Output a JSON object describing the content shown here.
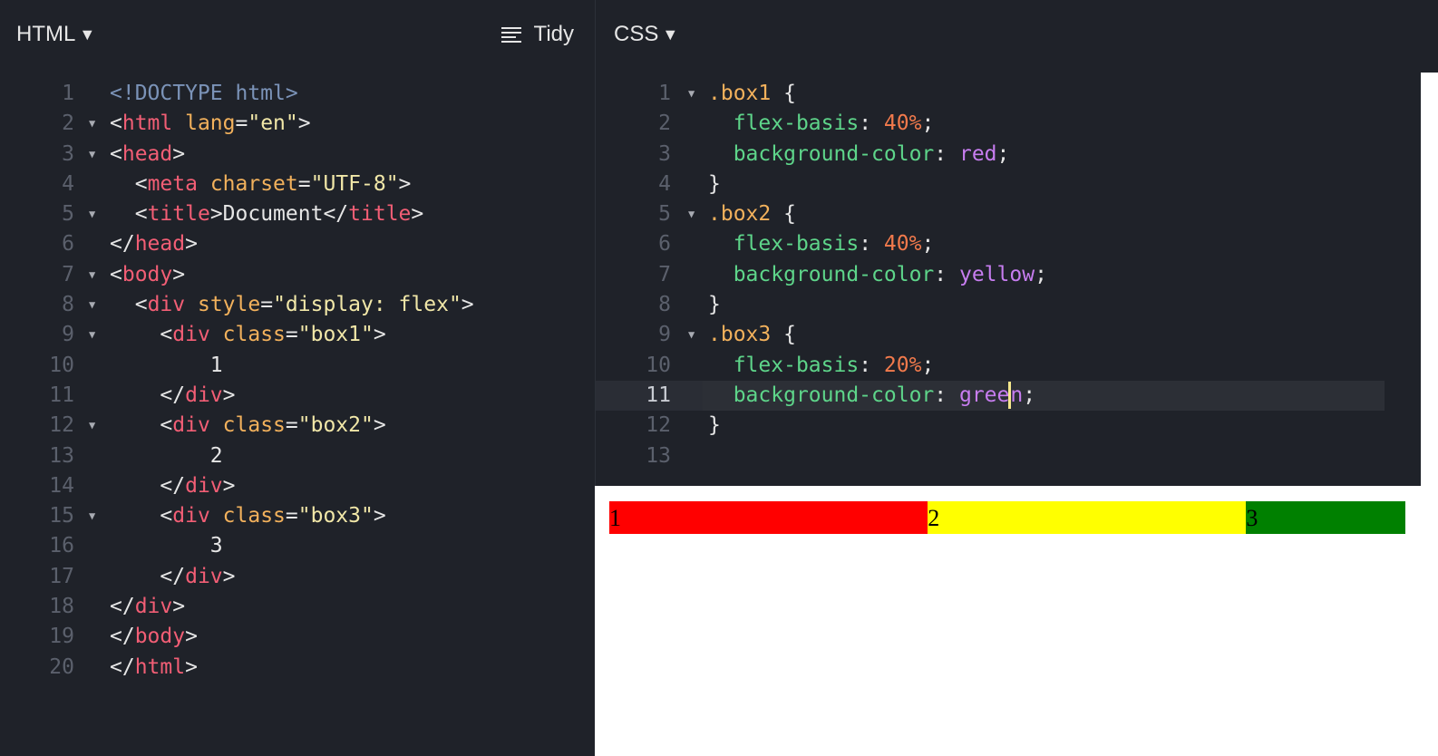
{
  "html_pane": {
    "title": "HTML",
    "caret": "▼",
    "tidy_label": "Tidy",
    "lines": [
      {
        "n": "1",
        "fold": false,
        "indent": "",
        "tokens": [
          [
            "c-doc",
            "<!DOCTYPE html>"
          ]
        ]
      },
      {
        "n": "2",
        "fold": true,
        "indent": "",
        "tokens": [
          [
            "c-punc",
            "<"
          ],
          [
            "c-tag",
            "html"
          ],
          [
            "c-punc",
            " "
          ],
          [
            "c-attr",
            "lang"
          ],
          [
            "c-punc",
            "="
          ],
          [
            "c-str",
            "\"en\""
          ],
          [
            "c-punc",
            ">"
          ]
        ]
      },
      {
        "n": "3",
        "fold": true,
        "indent": "",
        "tokens": [
          [
            "c-punc",
            "<"
          ],
          [
            "c-tag",
            "head"
          ],
          [
            "c-punc",
            ">"
          ]
        ]
      },
      {
        "n": "4",
        "fold": false,
        "indent": "  ",
        "tokens": [
          [
            "c-punc",
            "<"
          ],
          [
            "c-tag",
            "meta"
          ],
          [
            "c-punc",
            " "
          ],
          [
            "c-attr",
            "charset"
          ],
          [
            "c-punc",
            "="
          ],
          [
            "c-str",
            "\"UTF-8\""
          ],
          [
            "c-punc",
            ">"
          ]
        ]
      },
      {
        "n": "5",
        "fold": true,
        "indent": "  ",
        "tokens": [
          [
            "c-punc",
            "<"
          ],
          [
            "c-tag",
            "title"
          ],
          [
            "c-punc",
            ">"
          ],
          [
            "c-text",
            "Document"
          ],
          [
            "c-punc",
            "</"
          ],
          [
            "c-tag",
            "title"
          ],
          [
            "c-punc",
            ">"
          ]
        ]
      },
      {
        "n": "6",
        "fold": false,
        "indent": "",
        "tokens": [
          [
            "c-punc",
            "</"
          ],
          [
            "c-tag",
            "head"
          ],
          [
            "c-punc",
            ">"
          ]
        ]
      },
      {
        "n": "7",
        "fold": true,
        "indent": "",
        "tokens": [
          [
            "c-punc",
            "<"
          ],
          [
            "c-tag",
            "body"
          ],
          [
            "c-punc",
            ">"
          ]
        ]
      },
      {
        "n": "8",
        "fold": true,
        "indent": "  ",
        "tokens": [
          [
            "c-punc",
            "<"
          ],
          [
            "c-tag",
            "div"
          ],
          [
            "c-punc",
            " "
          ],
          [
            "c-attr",
            "style"
          ],
          [
            "c-punc",
            "="
          ],
          [
            "c-str",
            "\"display: flex\""
          ],
          [
            "c-punc",
            ">"
          ]
        ]
      },
      {
        "n": "9",
        "fold": true,
        "indent": "    ",
        "tokens": [
          [
            "c-punc",
            "<"
          ],
          [
            "c-tag",
            "div"
          ],
          [
            "c-punc",
            " "
          ],
          [
            "c-attr",
            "class"
          ],
          [
            "c-punc",
            "="
          ],
          [
            "c-str",
            "\"box1\""
          ],
          [
            "c-punc",
            ">"
          ]
        ]
      },
      {
        "n": "10",
        "fold": false,
        "indent": "        ",
        "tokens": [
          [
            "c-text",
            "1"
          ]
        ]
      },
      {
        "n": "11",
        "fold": false,
        "indent": "    ",
        "tokens": [
          [
            "c-punc",
            "</"
          ],
          [
            "c-tag",
            "div"
          ],
          [
            "c-punc",
            ">"
          ]
        ]
      },
      {
        "n": "12",
        "fold": true,
        "indent": "    ",
        "tokens": [
          [
            "c-punc",
            "<"
          ],
          [
            "c-tag",
            "div"
          ],
          [
            "c-punc",
            " "
          ],
          [
            "c-attr",
            "class"
          ],
          [
            "c-punc",
            "="
          ],
          [
            "c-str",
            "\"box2\""
          ],
          [
            "c-punc",
            ">"
          ]
        ]
      },
      {
        "n": "13",
        "fold": false,
        "indent": "        ",
        "tokens": [
          [
            "c-text",
            "2"
          ]
        ]
      },
      {
        "n": "14",
        "fold": false,
        "indent": "    ",
        "tokens": [
          [
            "c-punc",
            "</"
          ],
          [
            "c-tag",
            "div"
          ],
          [
            "c-punc",
            ">"
          ]
        ]
      },
      {
        "n": "15",
        "fold": true,
        "indent": "    ",
        "tokens": [
          [
            "c-punc",
            "<"
          ],
          [
            "c-tag",
            "div"
          ],
          [
            "c-punc",
            " "
          ],
          [
            "c-attr",
            "class"
          ],
          [
            "c-punc",
            "="
          ],
          [
            "c-str",
            "\"box3\""
          ],
          [
            "c-punc",
            ">"
          ]
        ]
      },
      {
        "n": "16",
        "fold": false,
        "indent": "        ",
        "tokens": [
          [
            "c-text",
            "3"
          ]
        ]
      },
      {
        "n": "17",
        "fold": false,
        "indent": "    ",
        "tokens": [
          [
            "c-punc",
            "</"
          ],
          [
            "c-tag",
            "div"
          ],
          [
            "c-punc",
            ">"
          ]
        ]
      },
      {
        "n": "18",
        "fold": false,
        "indent": "",
        "tokens": [
          [
            "c-punc",
            "</"
          ],
          [
            "c-tag",
            "div"
          ],
          [
            "c-punc",
            ">"
          ]
        ]
      },
      {
        "n": "19",
        "fold": false,
        "indent": "",
        "tokens": [
          [
            "c-punc",
            "</"
          ],
          [
            "c-tag",
            "body"
          ],
          [
            "c-punc",
            ">"
          ]
        ]
      },
      {
        "n": "20",
        "fold": false,
        "indent": "",
        "tokens": [
          [
            "c-punc",
            "</"
          ],
          [
            "c-tag",
            "html"
          ],
          [
            "c-punc",
            ">"
          ]
        ]
      }
    ]
  },
  "css_pane": {
    "title": "CSS",
    "caret": "▼",
    "active_line": "11",
    "lines": [
      {
        "n": "1",
        "fold": true,
        "indent": "",
        "tokens": [
          [
            "c-sel",
            ".box1"
          ],
          [
            "c-punc",
            " {"
          ]
        ]
      },
      {
        "n": "2",
        "fold": false,
        "indent": "  ",
        "tokens": [
          [
            "c-prop",
            "flex-basis"
          ],
          [
            "c-punc",
            ": "
          ],
          [
            "c-num",
            "40%"
          ],
          [
            "c-punc",
            ";"
          ]
        ]
      },
      {
        "n": "3",
        "fold": false,
        "indent": "  ",
        "tokens": [
          [
            "c-prop",
            "background-color"
          ],
          [
            "c-punc",
            ": "
          ],
          [
            "c-kw",
            "red"
          ],
          [
            "c-punc",
            ";"
          ]
        ]
      },
      {
        "n": "4",
        "fold": false,
        "indent": "",
        "tokens": [
          [
            "c-punc",
            "}"
          ]
        ]
      },
      {
        "n": "5",
        "fold": true,
        "indent": "",
        "tokens": [
          [
            "c-sel",
            ".box2"
          ],
          [
            "c-punc",
            " {"
          ]
        ]
      },
      {
        "n": "6",
        "fold": false,
        "indent": "  ",
        "tokens": [
          [
            "c-prop",
            "flex-basis"
          ],
          [
            "c-punc",
            ": "
          ],
          [
            "c-num",
            "40%"
          ],
          [
            "c-punc",
            ";"
          ]
        ]
      },
      {
        "n": "7",
        "fold": false,
        "indent": "  ",
        "tokens": [
          [
            "c-prop",
            "background-color"
          ],
          [
            "c-punc",
            ": "
          ],
          [
            "c-kw",
            "yellow"
          ],
          [
            "c-punc",
            ";"
          ]
        ]
      },
      {
        "n": "8",
        "fold": false,
        "indent": "",
        "tokens": [
          [
            "c-punc",
            "}"
          ]
        ]
      },
      {
        "n": "9",
        "fold": true,
        "indent": "",
        "tokens": [
          [
            "c-sel",
            ".box3"
          ],
          [
            "c-punc",
            " {"
          ]
        ]
      },
      {
        "n": "10",
        "fold": false,
        "indent": "  ",
        "tokens": [
          [
            "c-prop",
            "flex-basis"
          ],
          [
            "c-punc",
            ": "
          ],
          [
            "c-num",
            "20%"
          ],
          [
            "c-punc",
            ";"
          ]
        ]
      },
      {
        "n": "11",
        "fold": false,
        "indent": "  ",
        "tokens": [
          [
            "c-prop",
            "background-color"
          ],
          [
            "c-punc",
            ": "
          ],
          [
            "c-kw",
            "gree"
          ],
          [
            "cursor",
            ""
          ],
          [
            "c-kw",
            "n"
          ],
          [
            "c-punc",
            ";"
          ]
        ]
      },
      {
        "n": "12",
        "fold": false,
        "indent": "",
        "tokens": [
          [
            "c-punc",
            "}"
          ]
        ]
      },
      {
        "n": "13",
        "fold": false,
        "indent": "",
        "tokens": []
      }
    ]
  },
  "preview": {
    "boxes": [
      {
        "label": "1",
        "color": "red"
      },
      {
        "label": "2",
        "color": "yellow"
      },
      {
        "label": "3",
        "color": "green"
      }
    ]
  }
}
